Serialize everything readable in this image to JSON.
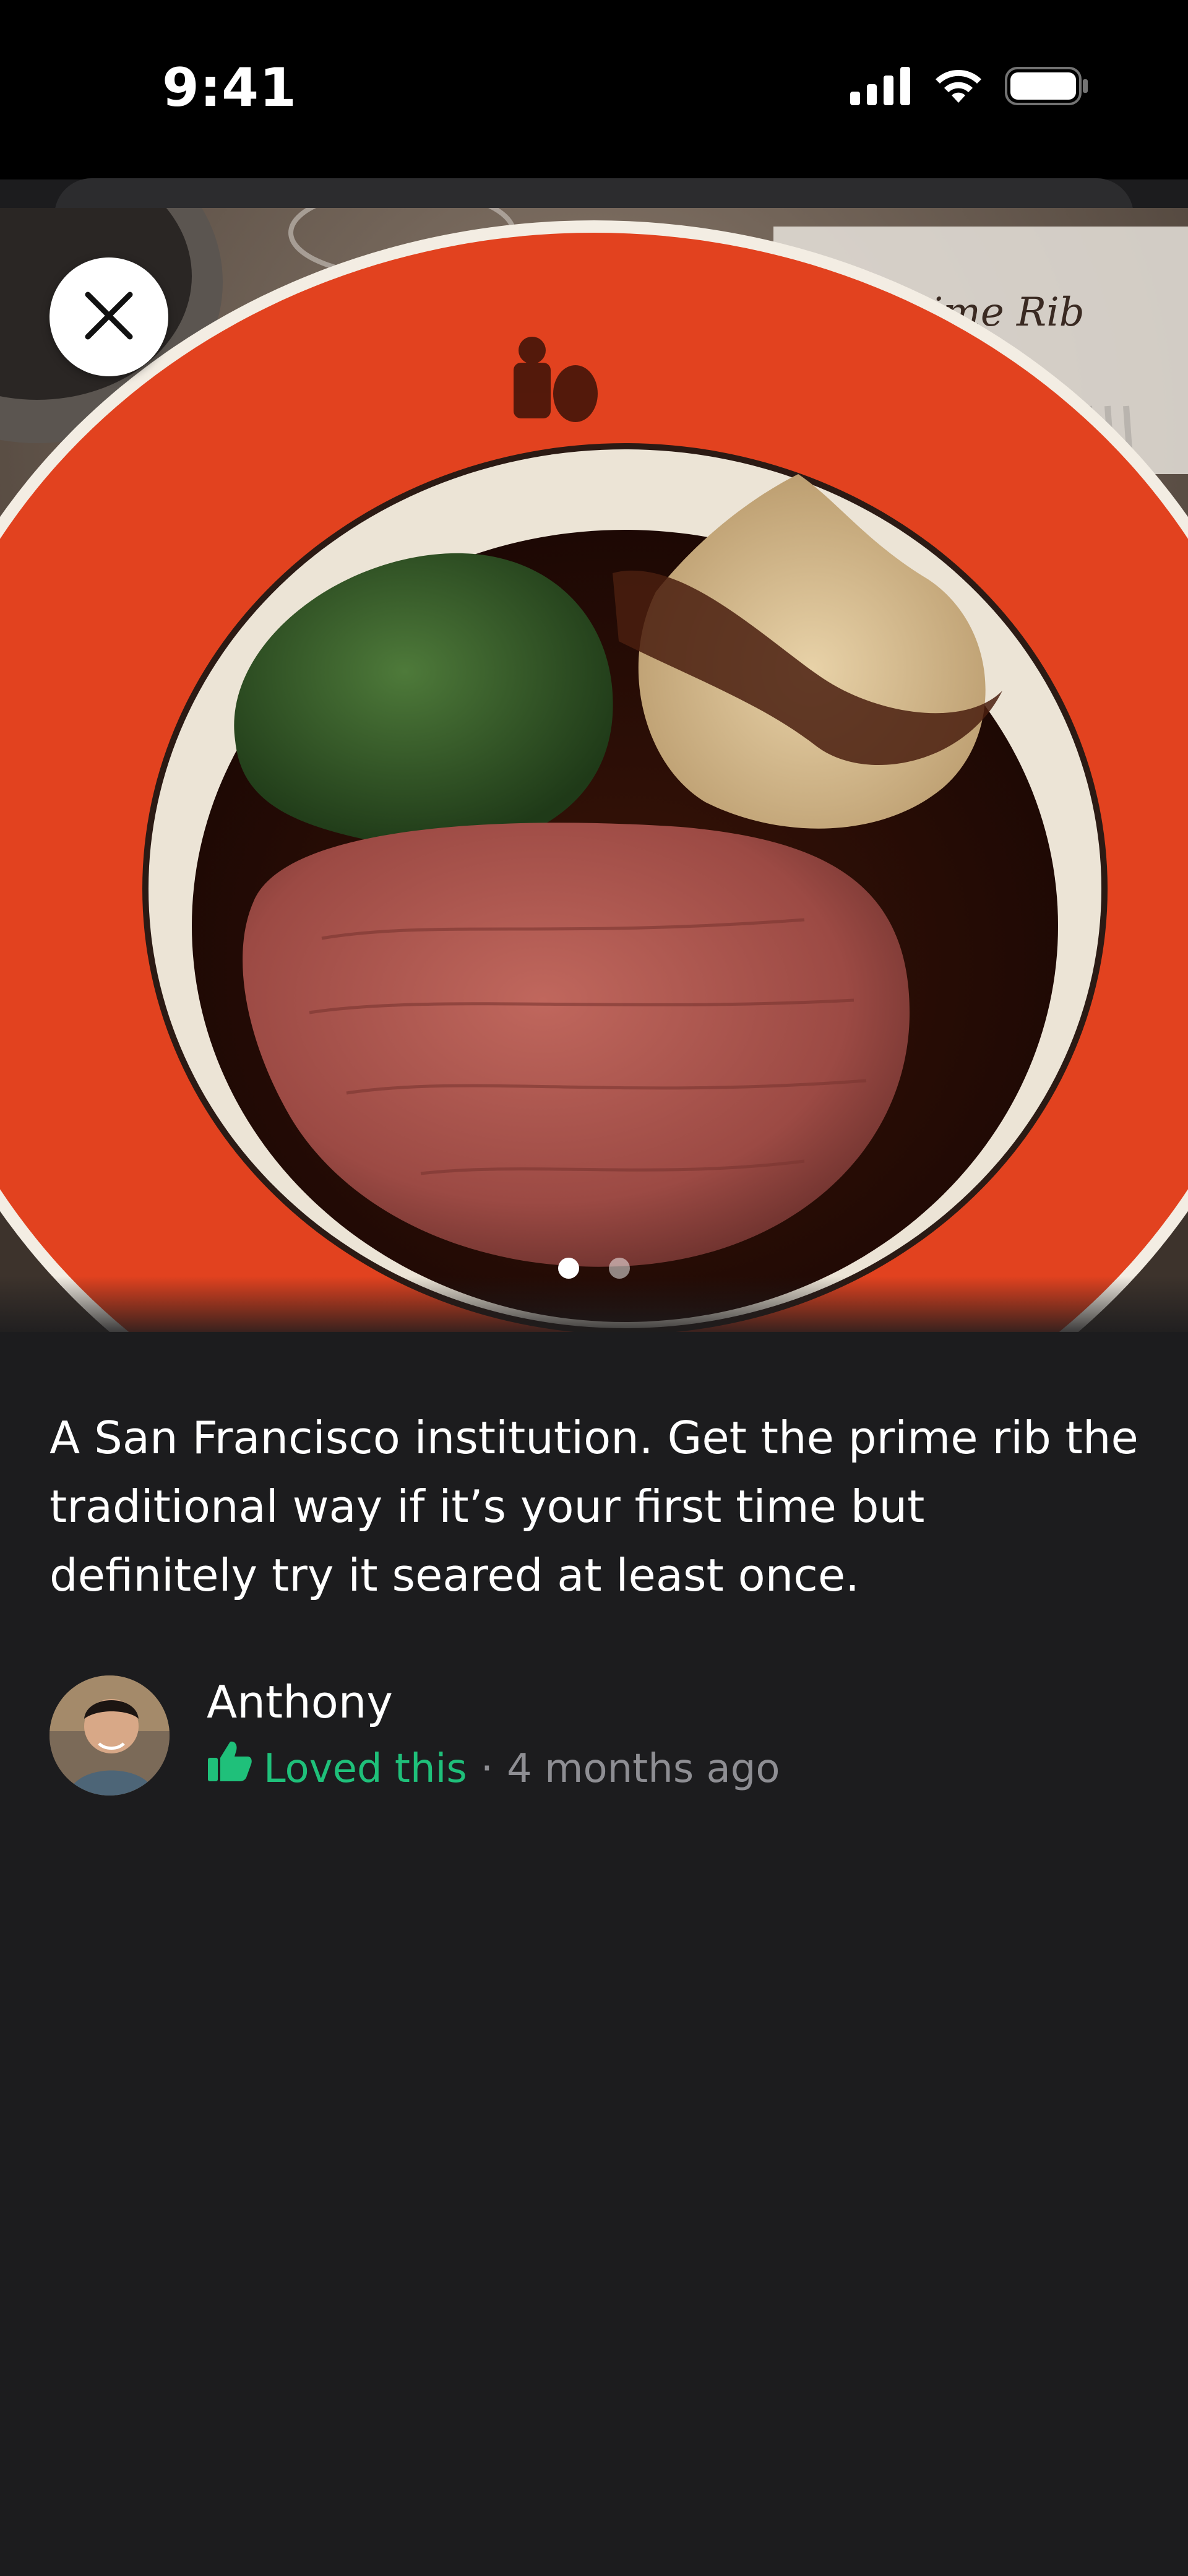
{
  "status_bar": {
    "time": "9:41",
    "icons": [
      "cellular-signal-icon",
      "wifi-icon",
      "battery-icon"
    ]
  },
  "photo": {
    "subject": "plate of prime rib with creamed spinach and mashed potatoes",
    "plate_text": "Prime Rib",
    "page_count": 2,
    "current_page": 1
  },
  "close": {
    "icon": "close-icon"
  },
  "review": {
    "text": "A San Francisco institution. Get the prime rib the traditional way if it’s your first time but definitely try it seared at least once."
  },
  "author": {
    "name": "Anthony",
    "reaction_label": "Loved this",
    "reaction_icon": "thumbs-up-icon",
    "separator": "·",
    "time_ago": "4 months ago"
  },
  "colors": {
    "background": "#1c1c1e",
    "accent_green": "#1fc07a",
    "secondary_text": "#8e8e93",
    "plate_rim": "#e2421f"
  }
}
